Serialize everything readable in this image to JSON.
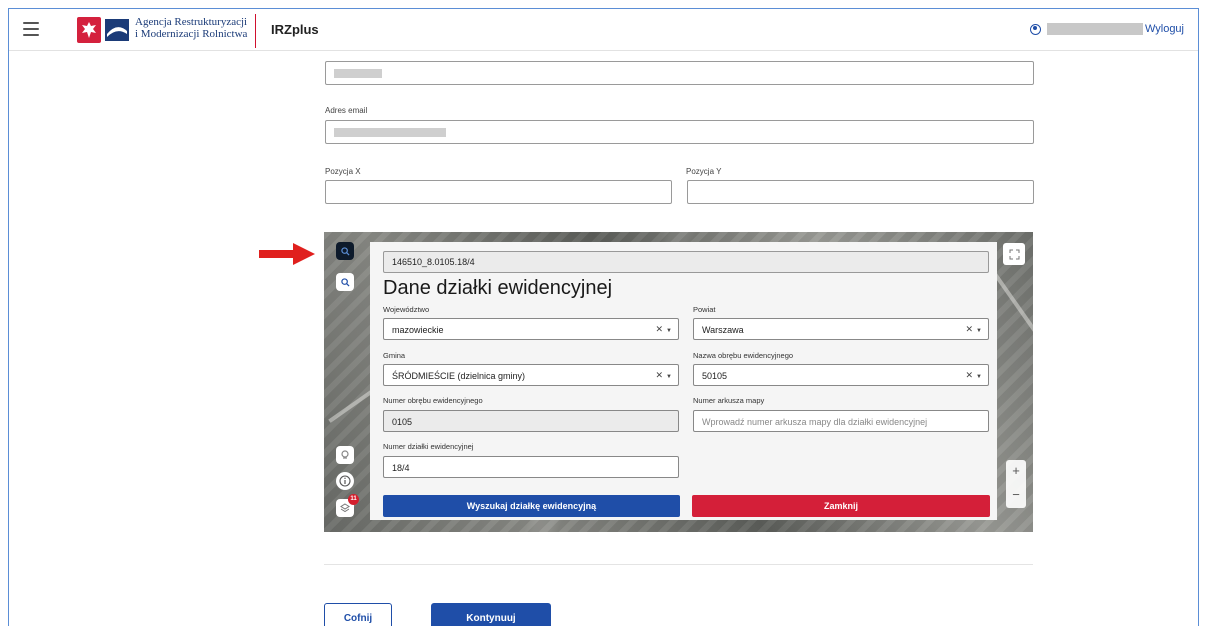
{
  "header": {
    "org_line1": "Agencja Restrukturyzacji",
    "org_line2": "i Modernizacji Rolnictwa",
    "app_title": "IRZplus",
    "logout_label": "Wyloguj"
  },
  "form": {
    "email_label": "Adres email",
    "pos_x_label": "Pozycja X",
    "pos_y_label": "Pozycja Y",
    "pos_x_value": "",
    "pos_y_value": ""
  },
  "map_panel": {
    "search_value": "146510_8.0105.18/4",
    "title": "Dane działki ewidencyjnej",
    "voivodeship_label": "Województwo",
    "voivodeship_value": "mazowieckie",
    "county_label": "Powiat",
    "county_value": "Warszawa",
    "commune_label": "Gmina",
    "commune_value": "ŚRÓDMIEŚCIE (dzielnica gminy)",
    "precinct_name_label": "Nazwa obrębu ewidencyjnego",
    "precinct_name_value": "50105",
    "precinct_number_label": "Numer obrębu ewidencyjnego",
    "precinct_number_value": "0105",
    "map_sheet_label": "Numer arkusza mapy",
    "map_sheet_placeholder": "Wprowadź numer arkusza mapy dla działki ewidencyjnej",
    "parcel_number_label": "Numer działki ewidencyjnej",
    "parcel_number_value": "18/4",
    "clear_symbol": "✕",
    "search_button": "Wyszukaj działkę ewidencyjną",
    "close_button": "Zamknij",
    "layers_badge": "11",
    "zoom_in": "+",
    "zoom_out": "−"
  },
  "footer": {
    "back_button": "Cofnij",
    "continue_button": "Kontynuuj"
  },
  "colors": {
    "primary": "#1f4ea8",
    "danger": "#d41f39",
    "arrow": "#e0201e"
  }
}
